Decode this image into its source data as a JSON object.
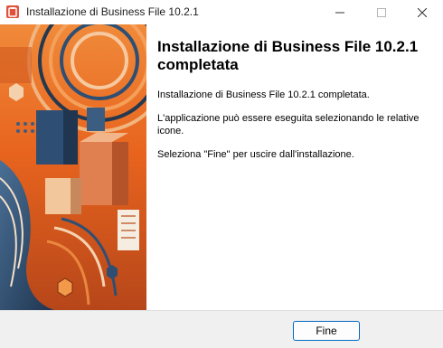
{
  "window": {
    "title": "Installazione di Business File 10.2.1",
    "app_icon": "app-icon",
    "controls": {
      "minimize_icon": "minimize-icon",
      "maximize_icon": "maximize-icon",
      "close_icon": "close-icon"
    }
  },
  "banner": {
    "image": "abstract-orange-blue-illustration"
  },
  "content": {
    "heading": "Installazione di Business File 10.2.1 completata",
    "paragraph1": "Installazione di Business File 10.2.1 completata.",
    "paragraph2": "L'applicazione può essere eseguita selezionando le relative icone.",
    "paragraph3": "Seleziona \"Fine\" per uscire dall'installazione."
  },
  "footer": {
    "finish_label": "Fine"
  },
  "colors": {
    "accent": "#0067c0",
    "footer_bg": "#f0f0f0",
    "banner_orange": "#e8641e",
    "banner_blue": "#2e4f73"
  }
}
